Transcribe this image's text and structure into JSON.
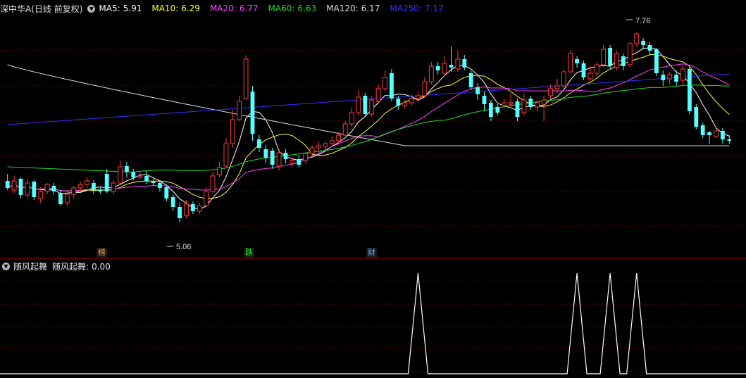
{
  "header": {
    "title": "深中华A(日线 前复权)",
    "ma": [
      {
        "label": "MA5:",
        "value": "5.91",
        "color": "#ffffff"
      },
      {
        "label": "MA10:",
        "value": "6.29",
        "color": "#ffff33"
      },
      {
        "label": "MA20:",
        "value": "6.77",
        "color": "#ff44ff"
      },
      {
        "label": "MA60:",
        "value": "6.63",
        "color": "#22dd22"
      },
      {
        "label": "MA120:",
        "value": "6.17",
        "color": "#dcdcdc"
      },
      {
        "label": "MA250:",
        "value": "7.17",
        "color": "#3333ff"
      }
    ]
  },
  "indicator": {
    "name": "随风起舞",
    "label": "随风起舞:",
    "value": "0.00"
  },
  "tags": [
    {
      "text": "榜",
      "color": "#ff9933"
    },
    {
      "text": "跌",
      "color": "#22ee22"
    },
    {
      "text": "财",
      "color": "#66aaff"
    }
  ],
  "annotations": {
    "high": "7.76",
    "low": "5.06"
  },
  "colors": {
    "up": "#ff3c3c",
    "down": "#54ffff",
    "grid": "#6e0000",
    "separator": "#a00000"
  },
  "chart_data": {
    "type": "candlestick",
    "price_range": [
      4.7,
      8.0
    ],
    "candles": [
      [
        5.65,
        5.55,
        5.75,
        5.52
      ],
      [
        5.52,
        5.65,
        5.72,
        5.48
      ],
      [
        5.68,
        5.45,
        5.7,
        5.4
      ],
      [
        5.45,
        5.62,
        5.68,
        5.4
      ],
      [
        5.64,
        5.42,
        5.66,
        5.38
      ],
      [
        5.4,
        5.5,
        5.56,
        5.34
      ],
      [
        5.5,
        5.6,
        5.62,
        5.46
      ],
      [
        5.58,
        5.5,
        5.62,
        5.45
      ],
      [
        5.48,
        5.32,
        5.52,
        5.3
      ],
      [
        5.34,
        5.46,
        5.5,
        5.3
      ],
      [
        5.46,
        5.55,
        5.58,
        5.4
      ],
      [
        5.55,
        5.6,
        5.64,
        5.5
      ],
      [
        5.6,
        5.65,
        5.7,
        5.55
      ],
      [
        5.62,
        5.52,
        5.66,
        5.46
      ],
      [
        5.52,
        5.5,
        5.56,
        5.46
      ],
      [
        5.75,
        5.5,
        5.82,
        5.48
      ],
      [
        5.5,
        5.62,
        5.66,
        5.46
      ],
      [
        5.62,
        5.85,
        5.94,
        5.6
      ],
      [
        5.86,
        5.78,
        5.92,
        5.7
      ],
      [
        5.78,
        5.7,
        5.82,
        5.66
      ],
      [
        5.7,
        5.72,
        5.78,
        5.66
      ],
      [
        5.72,
        5.65,
        5.8,
        5.6
      ],
      [
        5.64,
        5.62,
        5.68,
        5.58
      ],
      [
        5.62,
        5.55,
        5.66,
        5.5
      ],
      [
        5.56,
        5.4,
        5.6,
        5.36
      ],
      [
        5.42,
        5.28,
        5.46,
        5.22
      ],
      [
        5.28,
        5.12,
        5.34,
        5.06
      ],
      [
        5.16,
        5.32,
        5.38,
        5.12
      ],
      [
        5.32,
        5.22,
        5.36,
        5.18
      ],
      [
        5.22,
        5.3,
        5.34,
        5.18
      ],
      [
        5.3,
        5.5,
        5.56,
        5.28
      ],
      [
        5.5,
        5.72,
        5.78,
        5.48
      ],
      [
        5.74,
        5.84,
        5.92,
        5.7
      ],
      [
        5.86,
        6.18,
        6.26,
        5.84
      ],
      [
        6.18,
        6.52,
        6.66,
        6.12
      ],
      [
        6.52,
        6.78,
        6.86,
        6.5
      ],
      [
        6.82,
        7.38,
        7.44,
        6.8
      ],
      [
        6.92,
        6.32,
        7.0,
        6.22
      ],
      [
        6.24,
        6.12,
        6.3,
        6.06
      ],
      [
        6.1,
        5.98,
        6.16,
        5.9
      ],
      [
        6.08,
        5.88,
        6.12,
        5.82
      ],
      [
        5.86,
        6.05,
        6.1,
        5.8
      ],
      [
        6.05,
        5.96,
        6.1,
        5.9
      ],
      [
        5.9,
        5.94,
        5.98,
        5.84
      ],
      [
        5.96,
        5.88,
        6.02,
        5.84
      ],
      [
        5.94,
        6.04,
        6.06,
        5.9
      ],
      [
        6.04,
        6.12,
        6.16,
        6.0
      ],
      [
        6.12,
        6.15,
        6.2,
        6.06
      ],
      [
        6.14,
        6.18,
        6.22,
        6.1
      ],
      [
        6.18,
        6.22,
        6.28,
        6.14
      ],
      [
        6.22,
        6.3,
        6.34,
        6.18
      ],
      [
        6.3,
        6.46,
        6.5,
        6.28
      ],
      [
        6.46,
        6.62,
        6.68,
        6.42
      ],
      [
        6.62,
        6.84,
        6.94,
        6.58
      ],
      [
        6.86,
        6.6,
        6.9,
        6.56
      ],
      [
        6.6,
        6.8,
        6.86,
        6.56
      ],
      [
        6.78,
        6.96,
        7.02,
        6.74
      ],
      [
        6.96,
        7.12,
        7.22,
        6.92
      ],
      [
        7.18,
        6.82,
        7.24,
        6.78
      ],
      [
        6.82,
        6.72,
        6.86,
        6.66
      ],
      [
        6.72,
        6.76,
        6.8,
        6.68
      ],
      [
        6.76,
        6.82,
        6.88,
        6.72
      ],
      [
        6.82,
        6.86,
        6.92,
        6.78
      ],
      [
        6.86,
        7.06,
        7.12,
        6.84
      ],
      [
        7.06,
        7.28,
        7.34,
        7.02
      ],
      [
        7.28,
        7.22,
        7.34,
        7.16
      ],
      [
        7.18,
        7.32,
        7.42,
        7.14
      ],
      [
        7.3,
        7.26,
        7.56,
        7.2
      ],
      [
        7.24,
        7.38,
        7.5,
        7.2
      ],
      [
        7.38,
        7.26,
        7.44,
        7.22
      ],
      [
        7.18,
        6.98,
        7.22,
        6.94
      ],
      [
        6.98,
        6.88,
        7.04,
        6.8
      ],
      [
        6.86,
        6.74,
        6.92,
        6.64
      ],
      [
        6.76,
        6.56,
        6.8,
        6.5
      ],
      [
        6.7,
        6.62,
        6.74,
        6.58
      ],
      [
        6.72,
        6.76,
        6.82,
        6.68
      ],
      [
        6.74,
        6.76,
        6.9,
        6.68
      ],
      [
        6.78,
        6.56,
        6.82,
        6.5
      ],
      [
        6.62,
        6.8,
        6.88,
        6.58
      ],
      [
        6.82,
        6.7,
        6.86,
        6.66
      ],
      [
        6.7,
        6.76,
        6.8,
        6.64
      ],
      [
        6.74,
        6.8,
        6.86,
        6.5
      ],
      [
        6.86,
        6.96,
        7.02,
        6.82
      ],
      [
        6.96,
        7.0,
        7.1,
        6.9
      ],
      [
        7.0,
        7.2,
        7.24,
        6.96
      ],
      [
        7.2,
        7.46,
        7.5,
        7.18
      ],
      [
        7.38,
        7.32,
        7.42,
        7.26
      ],
      [
        7.32,
        7.12,
        7.36,
        7.08
      ],
      [
        7.1,
        7.18,
        7.28,
        7.06
      ],
      [
        7.18,
        7.3,
        7.34,
        7.14
      ],
      [
        7.3,
        7.52,
        7.58,
        7.26
      ],
      [
        7.54,
        7.28,
        7.58,
        7.24
      ],
      [
        7.26,
        7.46,
        7.5,
        7.22
      ],
      [
        7.42,
        7.28,
        7.46,
        7.22
      ],
      [
        7.3,
        7.6,
        7.62,
        7.26
      ],
      [
        7.6,
        7.74,
        7.76,
        7.56
      ],
      [
        7.64,
        7.58,
        7.68,
        7.52
      ],
      [
        7.58,
        7.5,
        7.62,
        7.44
      ],
      [
        7.52,
        7.18,
        7.54,
        7.14
      ],
      [
        7.16,
        7.08,
        7.22,
        7.0
      ],
      [
        7.1,
        7.16,
        7.2,
        7.02
      ],
      [
        7.16,
        7.06,
        7.22,
        7.0
      ],
      [
        7.08,
        7.24,
        7.3,
        7.02
      ],
      [
        7.24,
        6.64,
        7.28,
        6.6
      ],
      [
        6.7,
        6.42,
        6.74,
        6.38
      ],
      [
        6.44,
        6.3,
        6.48,
        6.26
      ],
      [
        6.34,
        6.3,
        6.36,
        6.18
      ],
      [
        6.28,
        6.36,
        6.42,
        6.26
      ],
      [
        6.36,
        6.24,
        6.4,
        6.18
      ],
      [
        6.24,
        6.22,
        6.3,
        6.18
      ]
    ],
    "indicator_series": {
      "name": "随风起舞",
      "range": [
        0,
        1
      ],
      "signal_indices": [
        62,
        86,
        91,
        95
      ]
    }
  }
}
